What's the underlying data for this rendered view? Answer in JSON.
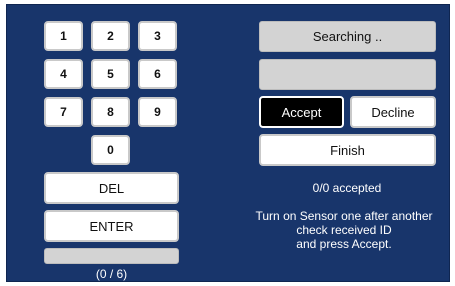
{
  "keypad": {
    "keys": [
      "1",
      "2",
      "3",
      "4",
      "5",
      "6",
      "7",
      "8",
      "9",
      "0"
    ],
    "del_label": "DEL",
    "enter_label": "ENTER",
    "counter": "(0 / 6)"
  },
  "right": {
    "status": "Searching ..",
    "received_id": "",
    "accept_label": "Accept",
    "decline_label": "Decline",
    "finish_label": "Finish",
    "accepted_count": "0/0 accepted",
    "instructions": [
      "Turn on Sensor one after another",
      "check received ID",
      "and press Accept."
    ]
  },
  "colors": {
    "panel_bg": "#18356b",
    "key_bg": "#ffffff",
    "accept_bg": "#000000",
    "grey_bar": "#d3d3d3"
  }
}
